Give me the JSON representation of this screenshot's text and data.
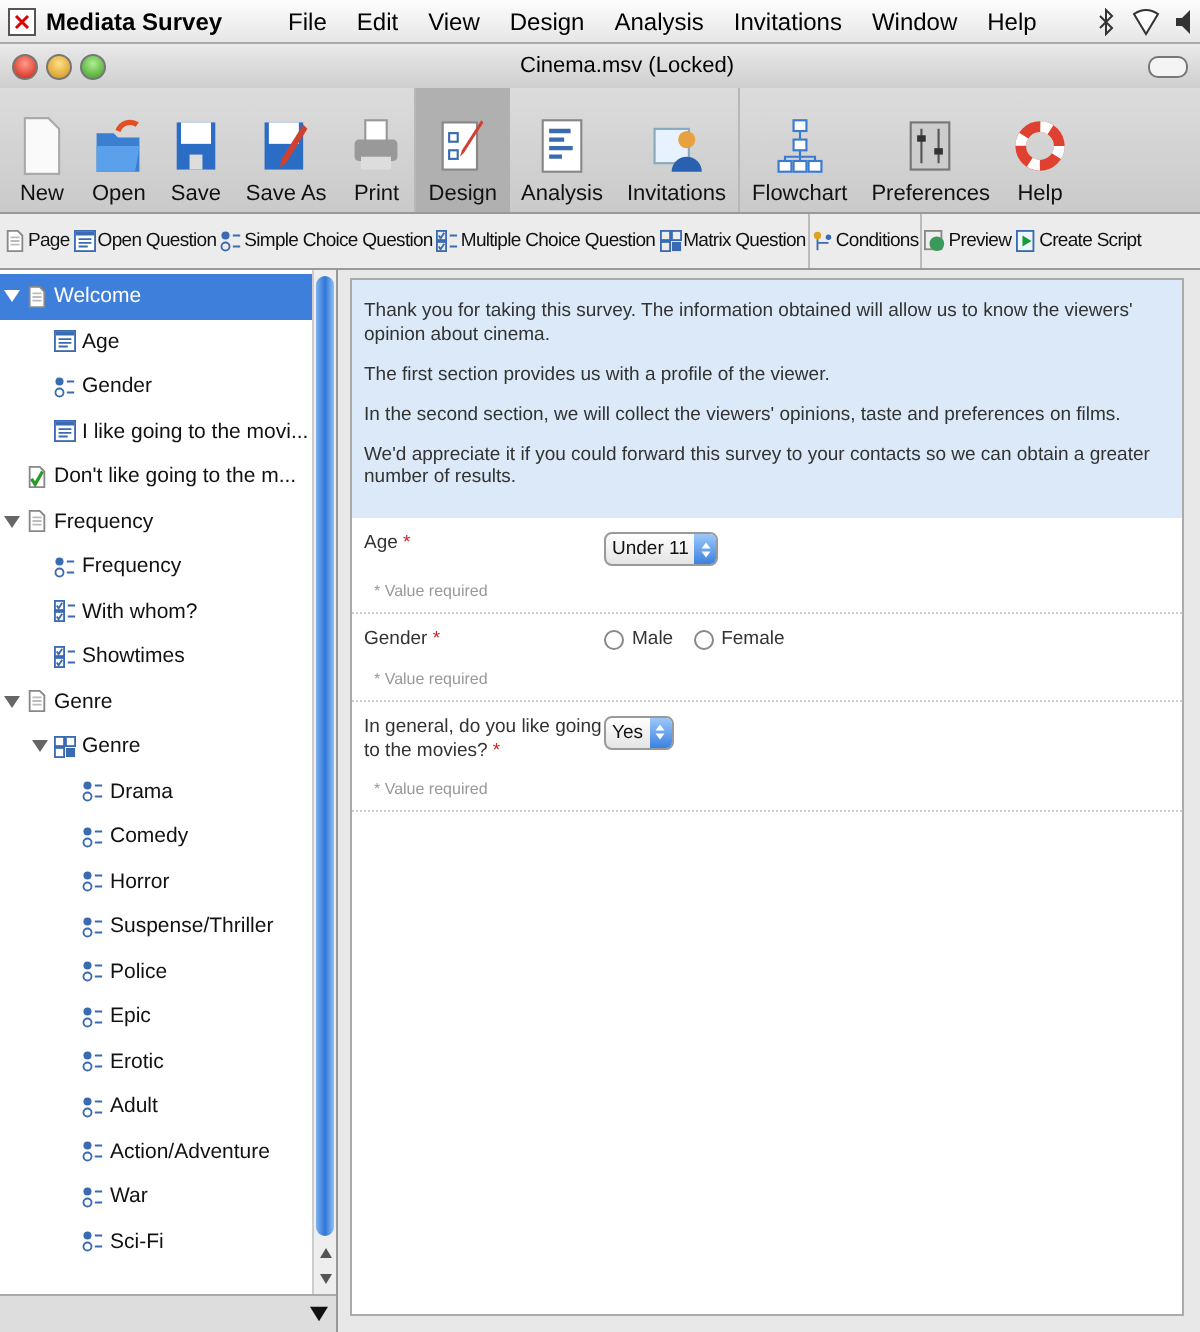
{
  "menubar": {
    "app_name": "Mediata Survey",
    "menus": [
      "File",
      "Edit",
      "View",
      "Design",
      "Analysis",
      "Invitations",
      "Window",
      "Help"
    ]
  },
  "window": {
    "title": "Cinema.msv (Locked)"
  },
  "toolbar": {
    "groups": [
      [
        {
          "label": "New",
          "kind": "new",
          "selected": false
        },
        {
          "label": "Open",
          "kind": "open",
          "selected": false
        },
        {
          "label": "Save",
          "kind": "save",
          "selected": false
        },
        {
          "label": "Save As",
          "kind": "saveas",
          "selected": false
        },
        {
          "label": "Print",
          "kind": "print",
          "selected": false
        }
      ],
      [
        {
          "label": "Design",
          "kind": "design",
          "selected": true
        },
        {
          "label": "Analysis",
          "kind": "analysis",
          "selected": false
        },
        {
          "label": "Invitations",
          "kind": "invitations",
          "selected": false
        }
      ],
      [
        {
          "label": "Flowchart",
          "kind": "flowchart",
          "selected": false
        },
        {
          "label": "Preferences",
          "kind": "preferences",
          "selected": false
        },
        {
          "label": "Help",
          "kind": "help",
          "selected": false
        }
      ]
    ]
  },
  "insert_toolbar": {
    "groups": [
      [
        {
          "label": "Page",
          "kind": "page"
        },
        {
          "label": "Open Question",
          "kind": "text"
        },
        {
          "label": "Simple Choice Question",
          "kind": "single"
        },
        {
          "label": "Multiple Choice Question",
          "kind": "multi"
        },
        {
          "label": "Matrix Question",
          "kind": "matrix"
        }
      ],
      [
        {
          "label": "Conditions",
          "kind": "conditions"
        }
      ],
      [
        {
          "label": "Preview",
          "kind": "preview"
        },
        {
          "label": "Create Script",
          "kind": "script"
        }
      ]
    ]
  },
  "tree": [
    {
      "label": "Welcome",
      "kind": "page",
      "selected": true,
      "expanded": true,
      "children": [
        {
          "label": "Age",
          "kind": "text",
          "selected": false
        },
        {
          "label": "Gender",
          "kind": "single",
          "selected": false
        },
        {
          "label": "I like going to the movi...",
          "kind": "text",
          "selected": false
        }
      ]
    },
    {
      "label": "Don't like going to the m...",
      "kind": "check",
      "selected": false
    },
    {
      "label": "Frequency",
      "kind": "page",
      "selected": false,
      "expanded": true,
      "children": [
        {
          "label": "Frequency",
          "kind": "single",
          "selected": false
        },
        {
          "label": "With whom?",
          "kind": "multi",
          "selected": false
        },
        {
          "label": "Showtimes",
          "kind": "multi",
          "selected": false
        }
      ]
    },
    {
      "label": "Genre",
      "kind": "page",
      "selected": false,
      "expanded": true,
      "children": [
        {
          "label": "Genre",
          "kind": "matrix",
          "selected": false,
          "expanded": true,
          "children": [
            {
              "label": "Drama",
              "kind": "single",
              "selected": false
            },
            {
              "label": "Comedy",
              "kind": "single",
              "selected": false
            },
            {
              "label": "Horror",
              "kind": "single",
              "selected": false
            },
            {
              "label": "Suspense/Thriller",
              "kind": "single",
              "selected": false
            },
            {
              "label": "Police",
              "kind": "single",
              "selected": false
            },
            {
              "label": "Epic",
              "kind": "single",
              "selected": false
            },
            {
              "label": "Erotic",
              "kind": "single",
              "selected": false
            },
            {
              "label": "Adult",
              "kind": "single",
              "selected": false
            },
            {
              "label": "Action/Adventure",
              "kind": "single",
              "selected": false
            },
            {
              "label": "War",
              "kind": "single",
              "selected": false
            },
            {
              "label": "Sci-Fi",
              "kind": "single",
              "selected": false
            }
          ]
        }
      ]
    }
  ],
  "intro": [
    "Thank you for taking this survey. The information obtained will allow us to know the viewers' opinion about cinema.",
    "The first section provides us with a profile of the viewer.",
    "In the second section, we will collect the viewers' opinions, taste and preferences on films.",
    "We'd appreciate it if you could forward this survey to your contacts so we can obtain a greater number of results."
  ],
  "questions": [
    {
      "label": "Age",
      "required_mark": "*",
      "kind": "select",
      "value": "Under 11",
      "hint": "* Value required"
    },
    {
      "label": "Gender",
      "required_mark": "*",
      "kind": "radio",
      "options": [
        {
          "label": "Male",
          "selected": false
        },
        {
          "label": "Female",
          "selected": false
        }
      ],
      "hint": "* Value required"
    },
    {
      "label": "In general, do you like going to the movies?",
      "required_mark": "*",
      "kind": "select",
      "value": "Yes",
      "hint": "* Value required"
    }
  ]
}
